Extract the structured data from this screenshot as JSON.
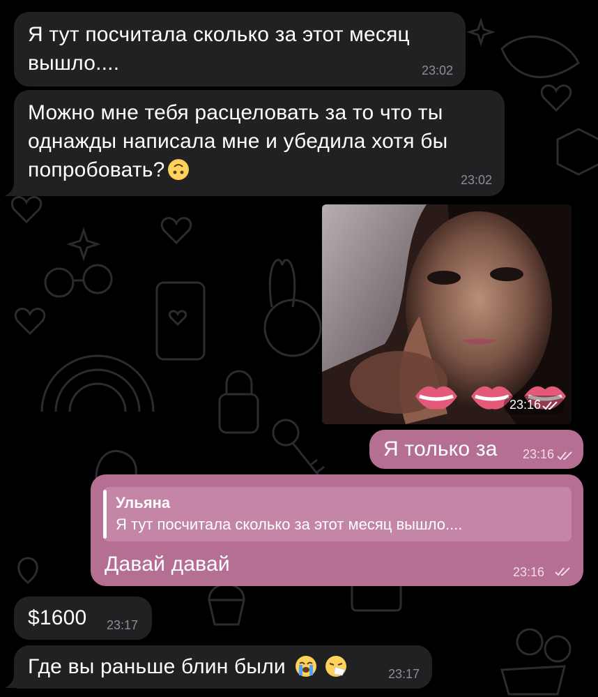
{
  "messages": [
    {
      "text_line1": "Я тут посчитала сколько за этот месяц",
      "text_line2": "вышло....",
      "time": "23:02"
    },
    {
      "text_line1": "Можно мне тебя расцеловать за то что ты",
      "text_line2": "однажды написала мне и убедила хотя бы",
      "text_line3": "попробовать?",
      "emoji": "upside-down-face-emoji",
      "time": "23:02"
    },
    {
      "kind": "photo",
      "time": "23:16"
    },
    {
      "text": "Я только за",
      "time": "23:16"
    },
    {
      "reply_author": "Ульяна",
      "reply_text": "Я тут посчитала сколько за этот месяц вышло....",
      "text": "Давай давай",
      "time": "23:16"
    },
    {
      "text": "$1600",
      "time": "23:17"
    },
    {
      "text": "Где вы раньше блин были",
      "emoji1": "loudly-crying-face-emoji",
      "emoji2": "sneezing-face-emoji",
      "time": "23:17"
    }
  ],
  "colors": {
    "background": "#000000",
    "incoming": "#212124",
    "outgoing": "#b56f93",
    "reply_quote": "#c585a6"
  },
  "icons": {
    "read_receipt": "double-check-icon"
  }
}
